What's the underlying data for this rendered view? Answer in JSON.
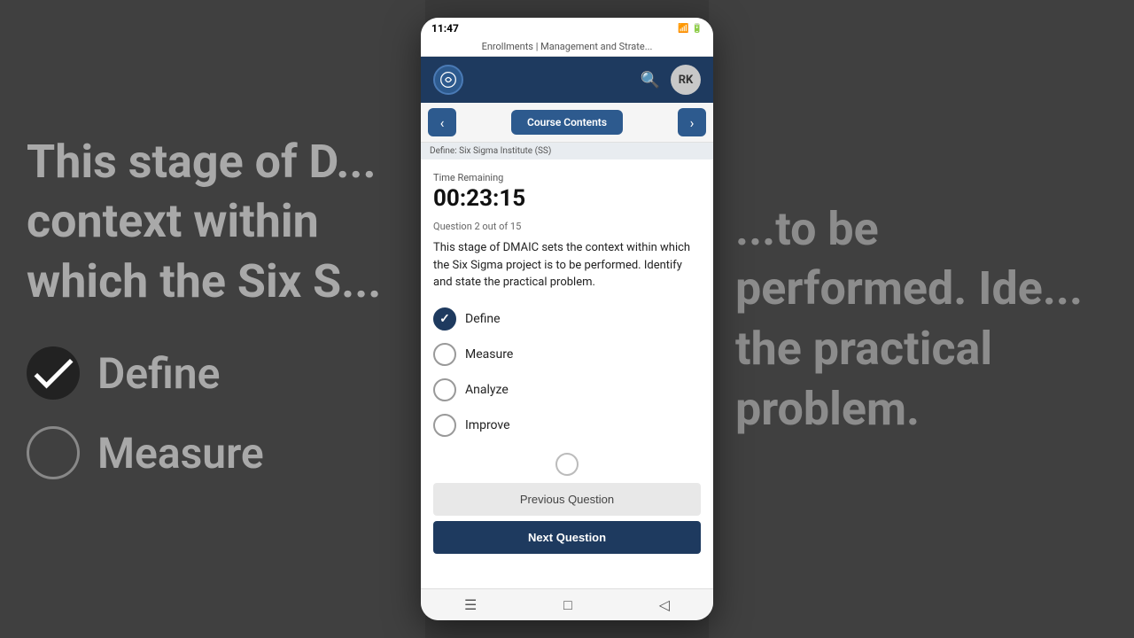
{
  "background": {
    "left_text": "This stage of D... context within which the Six S...",
    "right_text": "...to be performed. Ide... the practical problem.",
    "option_define_label": "Define",
    "option_measure_label": "Measure"
  },
  "status_bar": {
    "time": "11:47",
    "icons": "signal battery"
  },
  "browser_bar": {
    "url": "Enrollments | Management and Strate..."
  },
  "header": {
    "logo_alt": "Simplilearn logo",
    "avatar_initials": "RK"
  },
  "nav": {
    "back_label": "‹",
    "course_contents_label": "Course Contents",
    "forward_label": "›"
  },
  "breadcrumb": {
    "text": "Define: Six Sigma Institute (SS)"
  },
  "quiz": {
    "time_remaining_label": "Time Remaining",
    "time_remaining_value": "00:23:15",
    "question_progress": "Question 2 out of 15",
    "question_text": "This stage of DMAIC sets the context within which the Six Sigma project is to be performed. Identify and state the practical problem.",
    "options": [
      {
        "id": "define",
        "label": "Define",
        "selected": true
      },
      {
        "id": "measure",
        "label": "Measure",
        "selected": false
      },
      {
        "id": "analyze",
        "label": "Analyze",
        "selected": false
      },
      {
        "id": "improve",
        "label": "Improve",
        "selected": false
      }
    ],
    "previous_button_label": "Previous Question",
    "next_button_label": "Next Question"
  },
  "bottom_nav": {
    "menu_icon": "☰",
    "home_icon": "□",
    "back_icon": "◁"
  }
}
